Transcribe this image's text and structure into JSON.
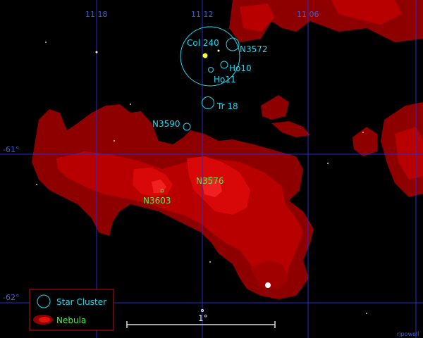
{
  "grid": {
    "ra_labels": [
      "11 18",
      "11 12",
      "11 06"
    ],
    "dec_labels": [
      "-61°",
      "-62°"
    ],
    "color": "#2a2ad0",
    "label_color": "#3f5fd0"
  },
  "clusters": [
    {
      "id": "col240",
      "label": "Col 240"
    },
    {
      "id": "n3572",
      "label": "N3572"
    },
    {
      "id": "ho10",
      "label": "Ho10"
    },
    {
      "id": "ho11",
      "label": "Ho11"
    },
    {
      "id": "tr18",
      "label": "Tr 18"
    },
    {
      "id": "n3590",
      "label": "N3590"
    }
  ],
  "nebula_labels": [
    {
      "id": "n3576",
      "label": "N3576"
    },
    {
      "id": "n3603",
      "label": "N3603"
    }
  ],
  "legend": {
    "star_cluster": "Star Cluster",
    "nebula": "Nebula",
    "border_color": "#c01010"
  },
  "scale": {
    "label": "1°"
  },
  "credit": "rjpowell",
  "colors": {
    "background": "#000000",
    "nebula_dark": "#8e0000",
    "nebula_mid": "#b80000",
    "nebula_bright": "#e01010",
    "cluster_line": "#22d8f0",
    "nebula_label": "#4ff04f",
    "star": "#ffffff",
    "highlight_star": "#ffff30"
  }
}
